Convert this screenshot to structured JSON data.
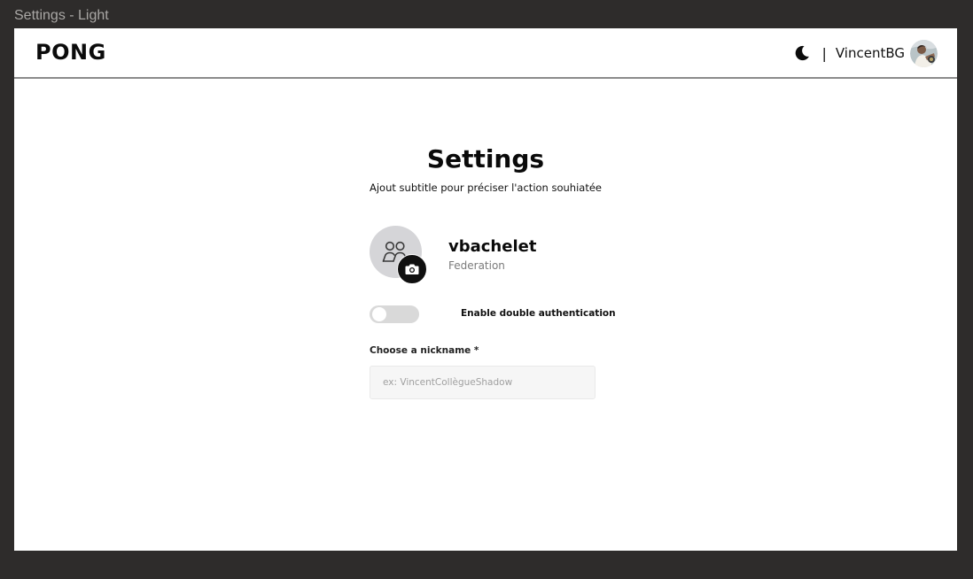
{
  "frame": {
    "label": "Settings - Light"
  },
  "header": {
    "logo": "PONG",
    "separator": "|",
    "username": "VincentBG",
    "theme_icon": "moon-icon"
  },
  "page": {
    "title": "Settings",
    "subtitle": "Ajout subtitle pour préciser l'action souhiatée"
  },
  "profile": {
    "name": "vbachelet",
    "organization": "Federation",
    "avatar_icon": "users-icon",
    "upload_icon": "camera-icon"
  },
  "two_factor": {
    "label": "Enable double authentication",
    "enabled": false
  },
  "nickname": {
    "label": "Choose a nickname *",
    "value": "",
    "placeholder": "ex: VincentCollègueShadow"
  },
  "colors": {
    "background": "#2e2c2b",
    "surface": "#ffffff",
    "text": "#0a0a0a",
    "muted": "#7b7b7b",
    "toggle_off": "#d9d9d9",
    "avatar_bg": "#d5d5d8",
    "input_bg": "#f6f6f6"
  }
}
